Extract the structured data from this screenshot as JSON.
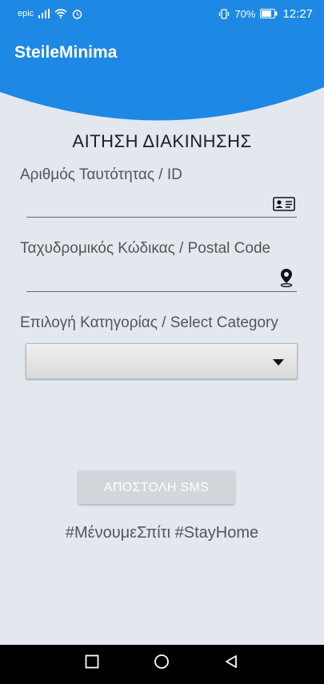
{
  "status_bar": {
    "carrier": "epic",
    "battery": "70%",
    "time": "12:27"
  },
  "app_bar": {
    "title": "SteileMinima"
  },
  "form": {
    "title": "ΑΙΤΗΣΗ ΔΙΑΚΙΝΗΣΗΣ",
    "id_label": "Αριθμός Ταυτότητας / ID",
    "id_value": "",
    "postal_label": "Ταχυδρομικός Κώδικας / Postal Code",
    "postal_value": "",
    "category_label": "Επιλογή Κατηγορίας / Select Category",
    "category_value": ""
  },
  "actions": {
    "send_sms_label": "ΑΠΟΣΤΟΛΗ SMS"
  },
  "footer": {
    "hashtag": "#ΜένουμεΣπίτι #StayHome"
  },
  "icons": {
    "id_card": "id-card-icon",
    "location": "location-pin-icon",
    "recent_apps": "square-icon",
    "home": "circle-icon",
    "back": "triangle-back-icon"
  },
  "colors": {
    "primary": "#1e88e5",
    "background": "#e3e8ef",
    "button": "#d3d6da"
  }
}
